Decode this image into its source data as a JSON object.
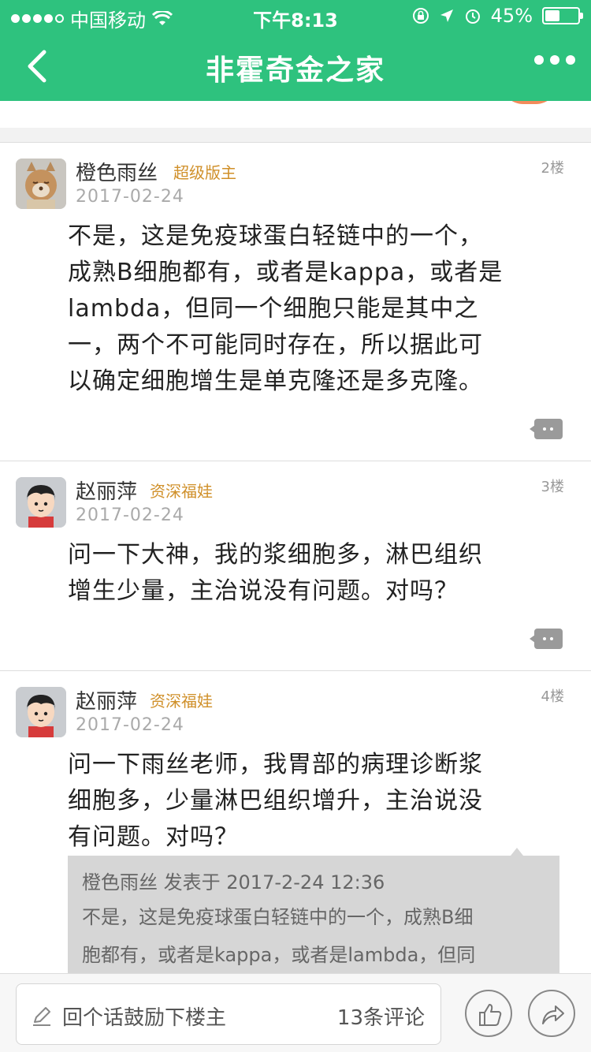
{
  "status_bar": {
    "carrier": "中国移动",
    "time": "下午8:13",
    "battery": "45%",
    "battery_level": 0.45
  },
  "nav": {
    "title": "非霍奇金之家"
  },
  "posts": [
    {
      "username": "橙色雨丝",
      "role": "超级版主",
      "date": "2017-02-24",
      "floor": "2楼",
      "lines": [
        "不是，这是免疫球蛋白轻链中的一个，",
        "成熟B细胞都有，或者是kappa，或者是",
        "lambda，但同一个细胞只能是其中之",
        "一，两个不可能同时存在，所以据此可",
        "以确定细胞增生是单克隆还是多克隆。"
      ],
      "avatar": "cat-avatar"
    },
    {
      "username": "赵丽萍",
      "role": "资深福娃",
      "date": "2017-02-24",
      "floor": "3楼",
      "lines": [
        "问一下大神，我的浆细胞多，淋巴组织",
        "增生少量，主治说没有问题。对吗？"
      ],
      "avatar": "cartoon-boy-avatar"
    },
    {
      "username": "赵丽萍",
      "role": "资深福娃",
      "date": "2017-02-24",
      "floor": "4楼",
      "lines": [
        "问一下雨丝老师，我胃部的病理诊断浆",
        "细胞多，少量淋巴组织增升，主治说没",
        "有问题。对吗？"
      ],
      "avatar": "cartoon-boy-avatar",
      "quote": {
        "header": "橙色雨丝 发表于 2017-2-24 12:36",
        "lines": [
          "不是，这是免疫球蛋白轻链中的一个，成熟B细",
          "胞都有，或者是kappa，或者是lambda，但同"
        ]
      }
    }
  ],
  "bottom_bar": {
    "comment_placeholder": "回个话鼓励下楼主",
    "comment_count": "13条评论"
  },
  "colors": {
    "primary": "#2ec27e",
    "role": "#d0902a",
    "quote_bg": "#d6d6d6"
  }
}
